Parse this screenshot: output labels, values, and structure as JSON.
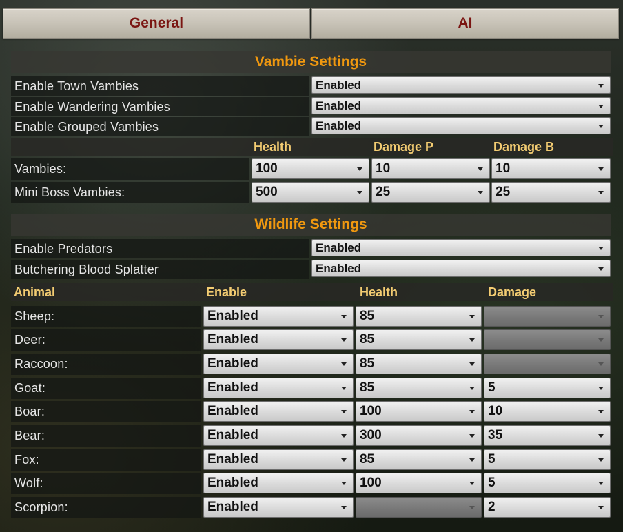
{
  "tabs": {
    "general": "General",
    "ai": "AI"
  },
  "vambie": {
    "title": "Vambie Settings",
    "toggles": [
      {
        "label": "Enable Town Vambies",
        "value": "Enabled"
      },
      {
        "label": "Enable Wandering Vambies",
        "value": "Enabled"
      },
      {
        "label": "Enable Grouped Vambies",
        "value": "Enabled"
      }
    ],
    "headers": {
      "health": "Health",
      "damage_p": "Damage P",
      "damage_b": "Damage B"
    },
    "rows": [
      {
        "label": "Vambies:",
        "health": "100",
        "damage_p": "10",
        "damage_b": "10"
      },
      {
        "label": "Mini Boss Vambies:",
        "health": "500",
        "damage_p": "25",
        "damage_b": "25"
      }
    ]
  },
  "wildlife": {
    "title": "Wildlife Settings",
    "toggles": [
      {
        "label": "Enable Predators",
        "value": "Enabled"
      },
      {
        "label": "Butchering Blood Splatter",
        "value": "Enabled"
      }
    ],
    "headers": {
      "animal": "Animal",
      "enable": "Enable",
      "health": "Health",
      "damage": "Damage"
    },
    "rows": [
      {
        "label": "Sheep:",
        "enable": "Enabled",
        "health": "85",
        "damage": ""
      },
      {
        "label": "Deer:",
        "enable": "Enabled",
        "health": "85",
        "damage": ""
      },
      {
        "label": "Raccoon:",
        "enable": "Enabled",
        "health": "85",
        "damage": ""
      },
      {
        "label": "Goat:",
        "enable": "Enabled",
        "health": "85",
        "damage": "5"
      },
      {
        "label": "Boar:",
        "enable": "Enabled",
        "health": "100",
        "damage": "10"
      },
      {
        "label": "Bear:",
        "enable": "Enabled",
        "health": "300",
        "damage": "35"
      },
      {
        "label": "Fox:",
        "enable": "Enabled",
        "health": "85",
        "damage": "5"
      },
      {
        "label": "Wolf:",
        "enable": "Enabled",
        "health": "100",
        "damage": "5"
      },
      {
        "label": "Scorpion:",
        "enable": "Enabled",
        "health": "",
        "damage": "2"
      }
    ]
  }
}
